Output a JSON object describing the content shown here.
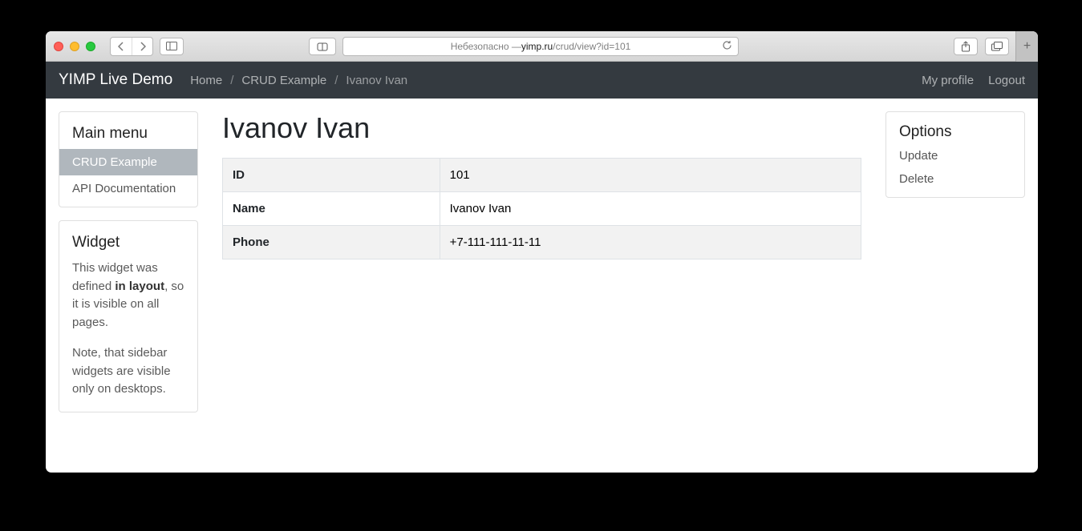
{
  "browser": {
    "address_prefix": "Небезопасно — ",
    "address_domain": "yimp.ru",
    "address_path": "/crud/view?id=101"
  },
  "navbar": {
    "brand": "YIMP Live Demo",
    "breadcrumb": [
      {
        "label": "Home",
        "active": false
      },
      {
        "label": "CRUD Example",
        "active": false
      },
      {
        "label": "Ivanov Ivan",
        "active": true
      }
    ],
    "right": {
      "profile": "My profile",
      "logout": "Logout"
    }
  },
  "sidebar": {
    "menu_title": "Main menu",
    "items": [
      {
        "label": "CRUD Example",
        "active": true
      },
      {
        "label": "API Documentation",
        "active": false
      }
    ],
    "widget": {
      "title": "Widget",
      "p1_a": "This widget was defined ",
      "p1_b": "in layout",
      "p1_c": ", so it is visible on all pages.",
      "p2": "Note, that sidebar widgets are visible only on desktops."
    }
  },
  "main": {
    "title": "Ivanov Ivan",
    "rows": [
      {
        "label": "ID",
        "value": "101"
      },
      {
        "label": "Name",
        "value": "Ivanov Ivan"
      },
      {
        "label": "Phone",
        "value": "+7-111-111-11-11"
      }
    ]
  },
  "options": {
    "title": "Options",
    "items": [
      {
        "label": "Update"
      },
      {
        "label": "Delete"
      }
    ]
  }
}
